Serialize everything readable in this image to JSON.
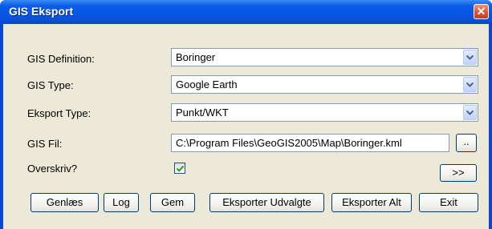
{
  "window": {
    "title": "GIS Eksport",
    "close_glyph": "✕"
  },
  "form": {
    "gis_definition": {
      "label": "GIS Definition:",
      "value": "Boringer"
    },
    "gis_type": {
      "label": "GIS Type:",
      "value": "Google Earth"
    },
    "eksport_type": {
      "label": "Eksport Type:",
      "value": "Punkt/WKT"
    },
    "gis_fil": {
      "label": "GIS Fil:",
      "value": "C:\\Program Files\\GeoGIS2005\\Map\\Boringer.kml",
      "browse_label": ".."
    },
    "overskriv": {
      "label": "Overskriv?",
      "checked": true
    }
  },
  "buttons": {
    "expand": ">>",
    "genlaes": "Genlæs",
    "log": "Log",
    "gem": "Gem",
    "eksporter_udvalgte": "Eksporter Udvalgte",
    "eksporter_alt": "Eksporter Alt",
    "exit": "Exit"
  },
  "colors": {
    "titlebar": "#0a5ce8",
    "client_background": "#ece9d8",
    "close_button": "#d8502c",
    "check_mark": "#21a121"
  },
  "icons": {
    "dropdown": "chevron-down-icon",
    "checkmark": "checkmark-icon",
    "close": "close-icon"
  }
}
